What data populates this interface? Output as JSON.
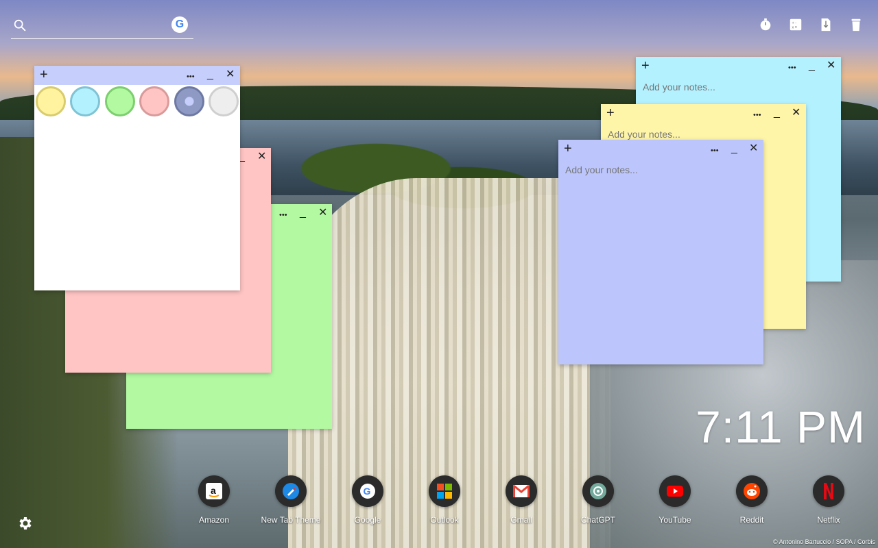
{
  "search": {
    "placeholder": ""
  },
  "notes": {
    "placeholder": "Add your notes...",
    "controls": {
      "add": "+",
      "menu": "•••",
      "minimize": "_",
      "close": "✕"
    },
    "colors": {
      "white": "#ffffff",
      "pink": "#ffc4c4",
      "green": "#b2f9a2",
      "cyan": "#b3f1ff",
      "yellow": "#fff5a8",
      "lavender": "#bcc6fc"
    },
    "swatches": [
      "#fff3a0",
      "#b3f1ff",
      "#b2f9a2",
      "#ffc4c4",
      "#8f9ac4",
      "#eeeeee"
    ]
  },
  "clock": {
    "time": "7:11 PM"
  },
  "dock": {
    "apps": [
      {
        "label": "Amazon",
        "icon": "amazon-icon"
      },
      {
        "label": "New Tab Theme",
        "icon": "new-tab-theme-icon"
      },
      {
        "label": "Google",
        "icon": "google-icon"
      },
      {
        "label": "Outlook",
        "icon": "outlook-icon"
      },
      {
        "label": "Gmail",
        "icon": "gmail-icon"
      },
      {
        "label": "ChatGPT",
        "icon": "chatgpt-icon"
      },
      {
        "label": "YouTube",
        "icon": "youtube-icon"
      },
      {
        "label": "Reddit",
        "icon": "reddit-icon"
      },
      {
        "label": "Netflix",
        "icon": "netflix-icon"
      }
    ]
  },
  "top_icons": [
    "timer-icon",
    "calculator-icon",
    "notes-toggle-icon",
    "trash-icon"
  ],
  "credit": "© Antonino Bartuccio / SOPA / Corbis"
}
